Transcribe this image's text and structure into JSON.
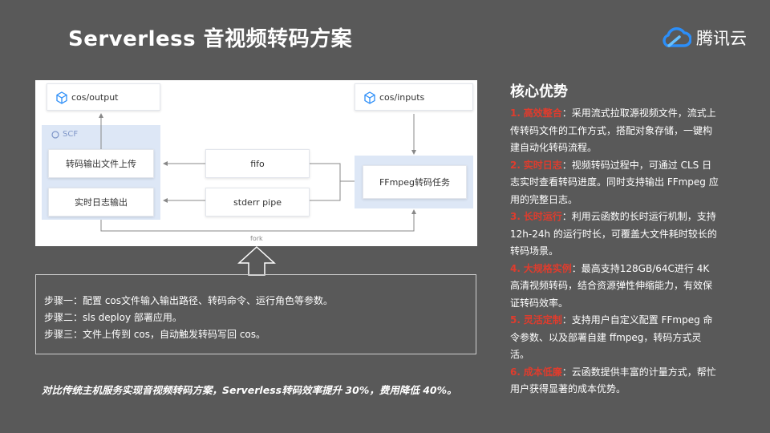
{
  "header": {
    "title": "Serverless 音视频转码方案",
    "brand": "腾讯云",
    "brand_color": "#2c8ef8",
    "logo_icon": "cloud-logo-icon"
  },
  "diagram": {
    "cos_output": "cos/output",
    "cos_inputs": "cos/inputs",
    "scf_label": "SCF",
    "upload_box": "转码输出文件上传",
    "log_box": "实时日志输出",
    "fifo": "fifo",
    "stderr": "stderr pipe",
    "ffmpeg": "FFmpeg转码任务",
    "fork": "fork"
  },
  "steps": [
    "步骤一：配置 cos文件输入输出路径、转码命令、运行角色等参数。",
    "步骤二：sls deploy 部署应用。",
    "步骤三：文件上传到 cos，自动触发转码写回 cos。"
  ],
  "summary": "对比传统主机服务实现音视频转码方案，Serverless转码效率提升 30%，费用降低 40%。",
  "advantages": {
    "title": "核心优势",
    "accent_color": "#e03c2d",
    "items": [
      {
        "num": "1.",
        "key": "高效整合",
        "text": "：采用流式拉取源视频文件，流式上传转码文件的工作方式，搭配对象存储，一键构建自动化转码流程。"
      },
      {
        "num": "2.",
        "key": "实时日志",
        "text": "：视频转码过程中，可通过 CLS 日志实时查看转码进度。同时支持输出 FFmpeg 应用的完整日志。"
      },
      {
        "num": "3.",
        "key": "长时运行",
        "text": "：利用云函数的长时运行机制，支持 12h-24h 的运行时长，可覆盖大文件耗时较长的转码场景。"
      },
      {
        "num": "4.",
        "key": "大规格实例",
        "text": "：最高支持128GB/64C进行 4K 高清视频转码，结合资源弹性伸缩能力，有效保证转码效率。"
      },
      {
        "num": "5.",
        "key": "灵活定制",
        "text": "：支持用户自定义配置 FFmpeg 命令参数、以及部署自建 ffmpeg，转码方式灵活。"
      },
      {
        "num": "6.",
        "key": "成本低廉",
        "text": "：云函数提供丰富的计量方式，帮忙用户获得显著的成本优势。"
      }
    ]
  }
}
